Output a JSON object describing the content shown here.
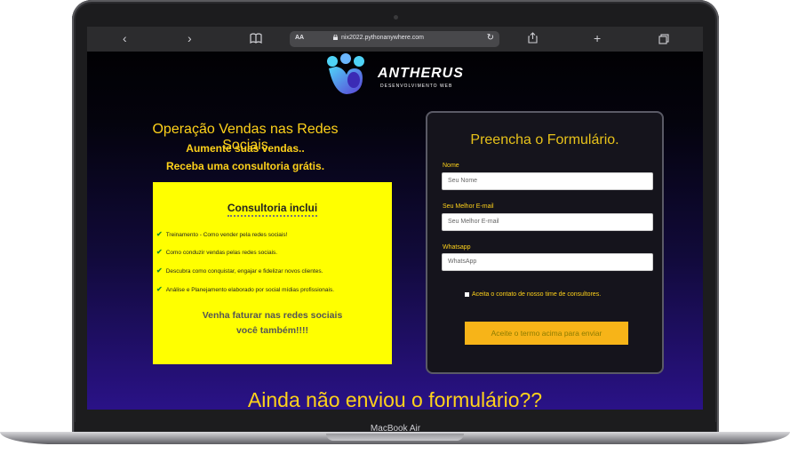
{
  "device": {
    "label": "MacBook Air"
  },
  "browser": {
    "text_size_label": "AA",
    "url": "nix2022.pythonanywhere.com",
    "icons": [
      "chevron-left-icon",
      "chevron-right-icon",
      "book-icon",
      "lock-icon",
      "reload-icon",
      "share-icon",
      "plus-icon",
      "tabs-icon"
    ]
  },
  "brand": {
    "name": "ANTHERUS",
    "tagline": "DESENVOLVIMENTO WEB",
    "colors": {
      "logo_light": "#4fd3f7",
      "logo_dark": "#5b3fd6"
    }
  },
  "hero": {
    "headline": "Operação Vendas nas Redes Sociais",
    "sub1": "Aumente suas vendas..",
    "sub2": "Receba uma consultoria grátis."
  },
  "consulting_box": {
    "title": "Consultoria inclui",
    "items": [
      "Treinamento - Como vender pela redes sociais!",
      "Como conduzir vendas pelas redes sociais.",
      "Descubra como conquistar, engajar e fidelizar novos clientes.",
      "Análise e Planejamento elaborado por social mídias profissionais."
    ],
    "footer_line1": "Venha faturar nas redes sociais",
    "footer_line2": "você também!!!!",
    "color": "#ffff00"
  },
  "form": {
    "title": "Preencha o Formulário.",
    "fields": [
      {
        "label": "Nome",
        "placeholder": "Seu Nome"
      },
      {
        "label": "Seu Melhor E-mail",
        "placeholder": "Seu Melhor E-mail"
      },
      {
        "label": "Whatsapp",
        "placeholder": "WhatsApp"
      }
    ],
    "consent_label": "Aceita o contato de nosso time de consultores.",
    "submit_label": "Aceite o termo acima para enviar",
    "accent": "#ffd21a",
    "button_color": "#f7b418"
  },
  "bottom_cta": "Ainda não enviou o formulário??"
}
